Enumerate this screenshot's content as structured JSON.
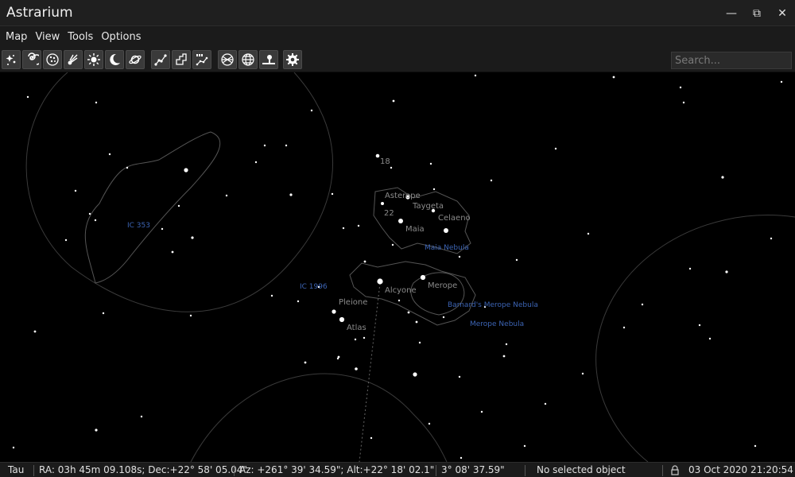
{
  "window": {
    "title": "Astrarium",
    "minimize_glyph": "—",
    "restore_glyph": "⧉",
    "close_glyph": "✕"
  },
  "menu": [
    "Map",
    "View",
    "Tools",
    "Options"
  ],
  "toolbar": {
    "buttons": [
      "stars-icon",
      "galaxies-icon",
      "clusters-icon",
      "comets-icon",
      "sun-icon",
      "moon-icon",
      "planets-icon",
      "constellation-lines-icon",
      "constellation-borders-icon",
      "constellation-labels-icon",
      "equatorial-grid-icon",
      "horizontal-grid-icon",
      "ground-icon",
      "settings-icon"
    ],
    "search_placeholder": "Search..."
  },
  "sky": {
    "object_labels": [
      "18",
      "Asterope",
      "22",
      "Taygeta",
      "Celaeno",
      "Maia",
      "Merope",
      "Alcyone",
      "Pleione",
      "Atlas"
    ],
    "nebula_labels": [
      "IC 353",
      "Maia Nebula",
      "IC 1996",
      "Barnard's Merope Nebula",
      "Merope Nebula"
    ]
  },
  "status": {
    "constellation": "Tau",
    "equatorial": "RA: 03h 45m 09.108s; Dec:+22° 58' 05.04\"",
    "horizontal": "Az: +261° 39' 34.59\"; Alt:+22° 18' 02.1\"",
    "fov": "3° 08' 37.59\"",
    "selection": "No selected object",
    "datetime": "03 Oct 2020 21:20:54"
  },
  "colors": {
    "background": "#000000",
    "chrome": "#1b1b1b",
    "star": "#ffffff",
    "label": "#8a8a8a",
    "nebula_label": "#3c64b4",
    "outline": "#555555"
  }
}
